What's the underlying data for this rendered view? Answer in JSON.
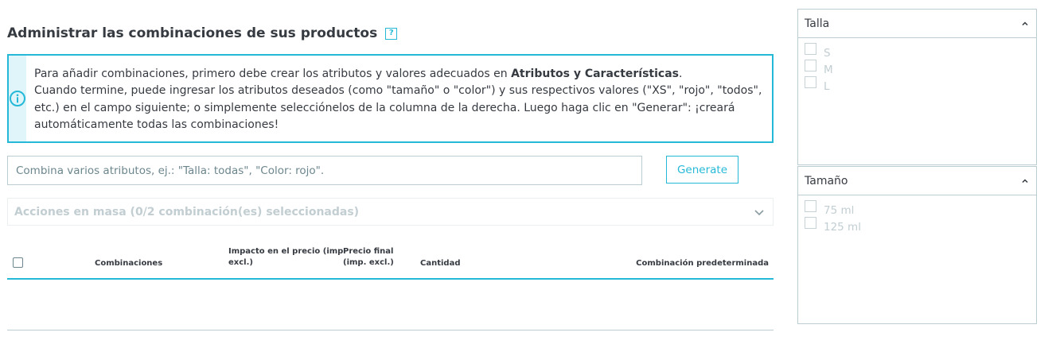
{
  "page": {
    "title": "Administrar las combinaciones de sus productos",
    "help_icon": "?"
  },
  "alert": {
    "icon": "info-circle-icon",
    "line1_prefix": "Para añadir combinaciones, primero debe crear los atributos y valores adecuados en ",
    "line1_link": "Atributos y Características",
    "line1_suffix": ".",
    "line2": "Cuando termine, puede ingresar los atributos deseados (como \"tamaño\" o \"color\") y sus respectivos valores (\"XS\", \"rojo\", \"todos\", etc.) en el campo siguiente; o simplemente selecciónelos de la columna de la derecha. Luego haga clic en \"Generar\": ¡creará automáticamente todas las combinaciones!"
  },
  "combine": {
    "placeholder": "Combina varios atributos, ej.: \"Talla: todas\", \"Color: rojo\".",
    "generate_label": "Generate"
  },
  "bulk": {
    "label": "Acciones en masa (0/2 combinación(es) seleccionadas)"
  },
  "table": {
    "columns": {
      "combinations": "Combinaciones",
      "price_impact_line1": "Impacto en el precio (imp",
      "price_impact_line2": "excl.)",
      "final_price_line1": "Precio final",
      "final_price_line2": "(imp. excl.)",
      "quantity": "Cantidad",
      "default": "Combinación predeterminada"
    }
  },
  "attributes": [
    {
      "name": "Talla",
      "values": [
        "S",
        "M",
        "L"
      ]
    },
    {
      "name": "Tamaño",
      "values": [
        "75 ml",
        "125 ml"
      ]
    }
  ],
  "colors": {
    "accent": "#25b9d7",
    "text": "#363a41",
    "muted": "#c2ced2",
    "border": "#bbcdd2",
    "alert_bg": "#dff5f9"
  }
}
